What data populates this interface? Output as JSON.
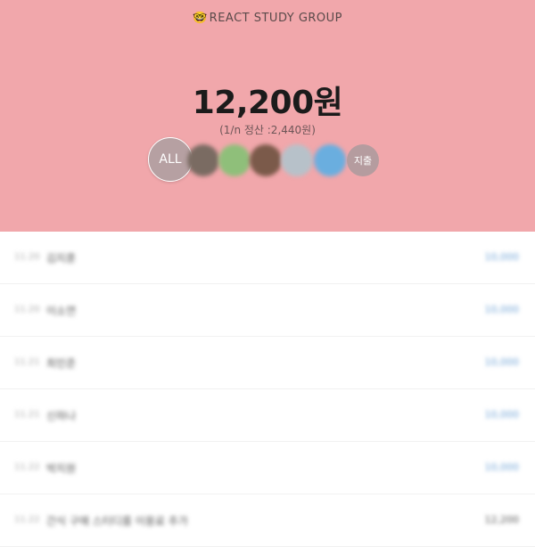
{
  "header": {
    "title_emoji": "🤓",
    "title": "REACT STUDY GROUP",
    "total_amount": "12,200원",
    "split_info": "(1/n 정산 :2,440원)",
    "bg_color": "#f1a7ab"
  },
  "members": {
    "all_label": "ALL",
    "expense_label": "지출",
    "avatars": [
      {
        "color": "#7a6b62"
      },
      {
        "color": "#8fbf7a"
      },
      {
        "color": "#7b5a4a"
      },
      {
        "color": "#b7c1c9"
      },
      {
        "color": "#6aaedf"
      }
    ]
  },
  "expenses": [
    {
      "date": "11.20",
      "name": "김지훈",
      "amount": "10,000",
      "color": "#6fa3d6"
    },
    {
      "date": "11.20",
      "name": "이소연",
      "amount": "10,000",
      "color": "#6fa3d6"
    },
    {
      "date": "11.21",
      "name": "최민준",
      "amount": "10,000",
      "color": "#6fa3d6"
    },
    {
      "date": "11.21",
      "name": "신하나",
      "amount": "10,000",
      "color": "#6fa3d6"
    },
    {
      "date": "11.22",
      "name": "박지원",
      "amount": "10,000",
      "color": "#6fa3d6"
    },
    {
      "date": "11.22",
      "name": "간식 구매 스터디룸 이용료 추가",
      "amount": "12,200",
      "color": "#555555"
    }
  ]
}
